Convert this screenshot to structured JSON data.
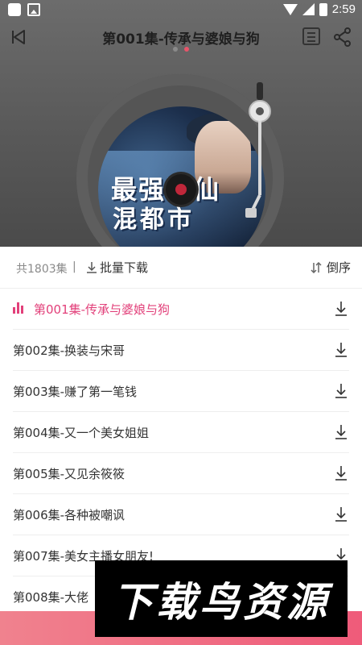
{
  "status_bar": {
    "time": "2:59"
  },
  "header": {
    "title": "第001集-传承与婆娘与狗",
    "pager_dots": 2,
    "active_dot": 1
  },
  "cover": {
    "art_line1": "最强医仙",
    "art_line2": "混都市"
  },
  "list_header": {
    "count_label": "共1803集",
    "separator": "|",
    "batch_download_label": "批量下载",
    "sort_label": "倒序"
  },
  "episodes": [
    {
      "title": "第001集-传承与婆娘与狗",
      "playing": true
    },
    {
      "title": "第002集-换装与宋哥",
      "playing": false
    },
    {
      "title": "第003集-赚了第一笔钱",
      "playing": false
    },
    {
      "title": "第004集-又一个美女姐姐",
      "playing": false
    },
    {
      "title": "第005集-又见余筱筱",
      "playing": false
    },
    {
      "title": "第006集-各种被嘲讽",
      "playing": false
    },
    {
      "title": "第007集-美女主播女朋友!",
      "playing": false
    },
    {
      "title": "第008集-大佬",
      "playing": false
    }
  ],
  "watermark": {
    "text": "下载鸟资源"
  },
  "colors": {
    "accent": "#e2407a",
    "bottom_bar": "#ef5b7a"
  },
  "icons": {
    "back": "back-triangle-icon",
    "playlist": "playlist-icon",
    "share": "share-icon",
    "download": "download-icon",
    "sort": "sort-icon",
    "playing": "equalizer-icon"
  }
}
